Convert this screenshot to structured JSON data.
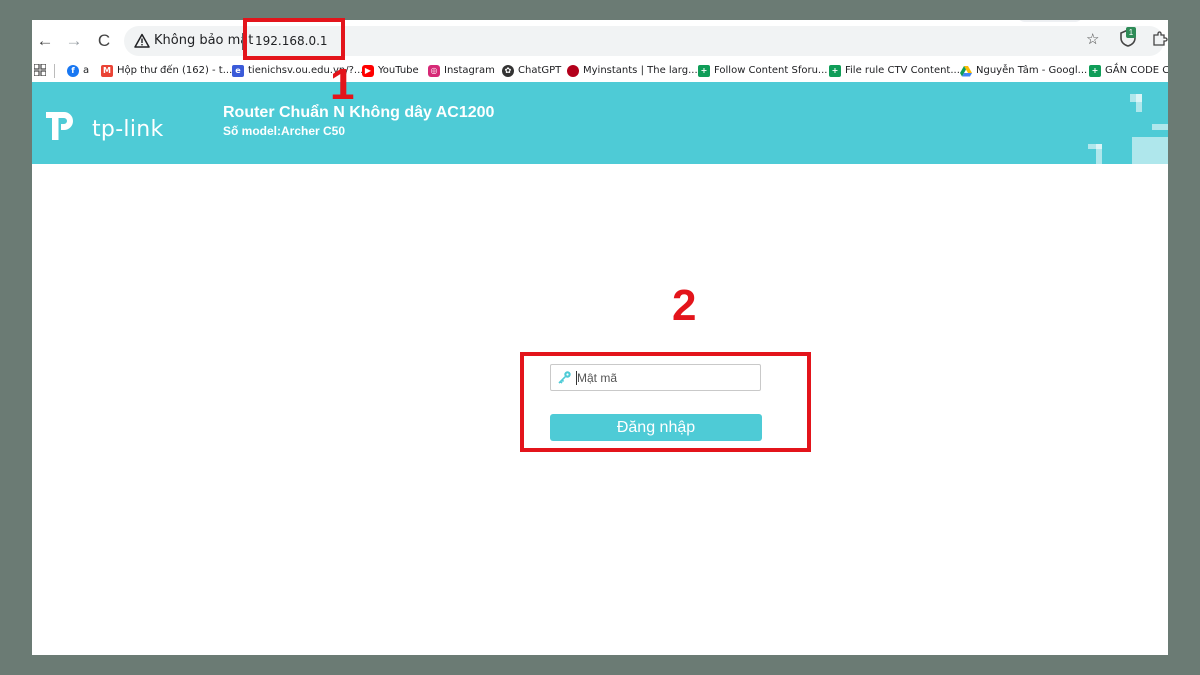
{
  "browser": {
    "nav": {
      "back_icon": "arrow-left-icon",
      "forward_icon": "arrow-right-icon",
      "reload_icon": "reload-icon"
    },
    "security_label": "Không bảo mật",
    "url": "192.168.0.1",
    "icons": [
      "warning-icon",
      "star-icon",
      "shield-extension-icon",
      "puzzle-icon"
    ],
    "extension_badge": "1"
  },
  "bookmarks": [
    {
      "label": "a",
      "icon": "facebook-icon",
      "color": "#1877f2"
    },
    {
      "label": "Hộp thư đến (162) - t...",
      "icon": "gmail-icon",
      "color": "#ea4335"
    },
    {
      "label": "tienichsv.ou.edu.vn/?...",
      "icon": "edu-icon",
      "color": "#3b5bd9"
    },
    {
      "label": "YouTube",
      "icon": "youtube-icon",
      "color": "#ff0000"
    },
    {
      "label": "Instagram",
      "icon": "instagram-icon",
      "color": "#d62976"
    },
    {
      "label": "ChatGPT",
      "icon": "chatgpt-icon",
      "color": "#333333"
    },
    {
      "label": "Myinstants | The larg...",
      "icon": "myinstants-icon",
      "color": "#b3001b"
    },
    {
      "label": "Follow Content Sforu...",
      "icon": "sheets-icon",
      "color": "#0f9d58"
    },
    {
      "label": "File rule CTV Content...",
      "icon": "sheets-icon",
      "color": "#0f9d58"
    },
    {
      "label": "Nguyễn Tâm - Googl...",
      "icon": "drive-icon",
      "color": "#fbbc04"
    },
    {
      "label": "GẮN CODE CA",
      "icon": "sheets-icon",
      "color": "#0f9d58"
    }
  ],
  "router": {
    "brand": "tp-link",
    "title": "Router Chuẩn N Không dây AC1200",
    "model": "Số model:Archer C50",
    "header_color": "#4ecbd6"
  },
  "login": {
    "password_placeholder": "Mật mã",
    "password_icon": "key-icon",
    "button_label": "Đăng nhập"
  },
  "annotations": {
    "step1": "1",
    "step2": "2",
    "color": "#e3141b"
  }
}
